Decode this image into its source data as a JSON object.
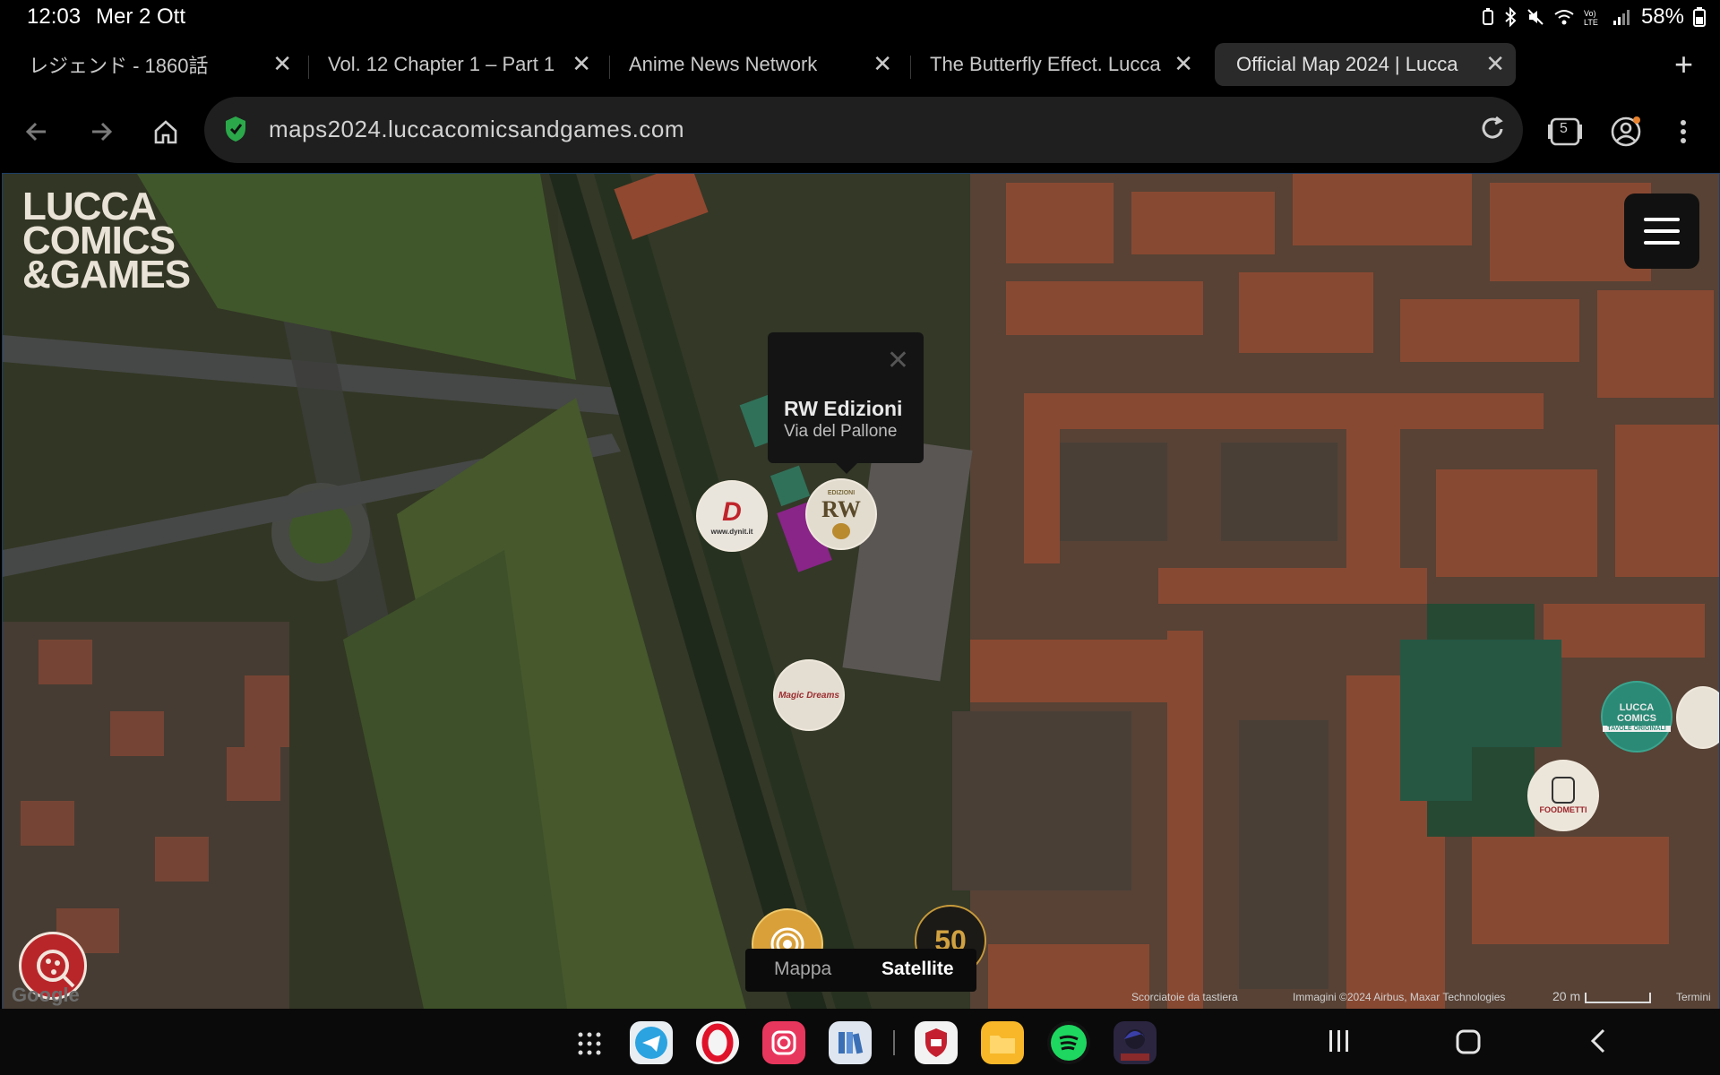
{
  "status_bar": {
    "time": "12:03",
    "date": "Mer 2 Ott",
    "battery": "58%",
    "icons": [
      "battery-saver-icon",
      "bluetooth-icon",
      "mute-icon",
      "wifi-icon",
      "volte-icon",
      "signal-icon"
    ]
  },
  "tabs": [
    {
      "title": "レジェンド - 1860話",
      "active": false
    },
    {
      "title": "Vol. 12 Chapter 1 – Part 1",
      "active": false
    },
    {
      "title": "Anime News Network",
      "active": false
    },
    {
      "title": "The Butterfly Effect. Lucca",
      "active": false
    },
    {
      "title": "Official Map 2024 | Lucca",
      "active": true
    }
  ],
  "tab_close_glyph": "✕",
  "new_tab_glyph": "+",
  "toolbar": {
    "url": "maps2024.luccacomicsandgames.com",
    "tab_count": "5"
  },
  "map": {
    "logo_lines": [
      "LUCCA",
      "COMICS",
      "&GAMES"
    ],
    "popup": {
      "title": "RW Edizioni",
      "subtitle": "Via del Pallone",
      "close_glyph": "✕"
    },
    "markers": [
      {
        "name": "dynit-marker",
        "label": "D",
        "sub": "www.dynit.it"
      },
      {
        "name": "rw-edizioni-marker",
        "label": "RW",
        "sub": "EDIZIONI"
      },
      {
        "name": "magic-dreams-marker",
        "label": "Magic Dreams"
      },
      {
        "name": "lucca-comics-tavole-marker",
        "label": "LUCCA COMICS",
        "sub": "TAVOLE ORIGINALI"
      },
      {
        "name": "foodmetti-marker",
        "label": "FOODMETTI"
      },
      {
        "name": "fifty-marker",
        "label": "50"
      }
    ],
    "type_toggle": {
      "map": "Mappa",
      "satellite": "Satellite",
      "selected": "Satellite"
    },
    "attribution": {
      "shortcuts": "Scorciatoie da tastiera",
      "imagery": "Immagini ©2024 Airbus, Maxar Technologies",
      "scale": "20 m",
      "terms": "Termini",
      "google": "Google"
    }
  },
  "dock": {
    "apps": [
      "telegram-icon",
      "opera-icon",
      "instagram-icon",
      "library-icon",
      "shield-app-icon",
      "files-icon",
      "spotify-icon",
      "game-avatar-icon"
    ]
  },
  "colors": {
    "accent_green": "#2ba84a",
    "map_roof": "#b5654a",
    "map_grass": "#4f5f34",
    "popup_bg": "#141414"
  }
}
